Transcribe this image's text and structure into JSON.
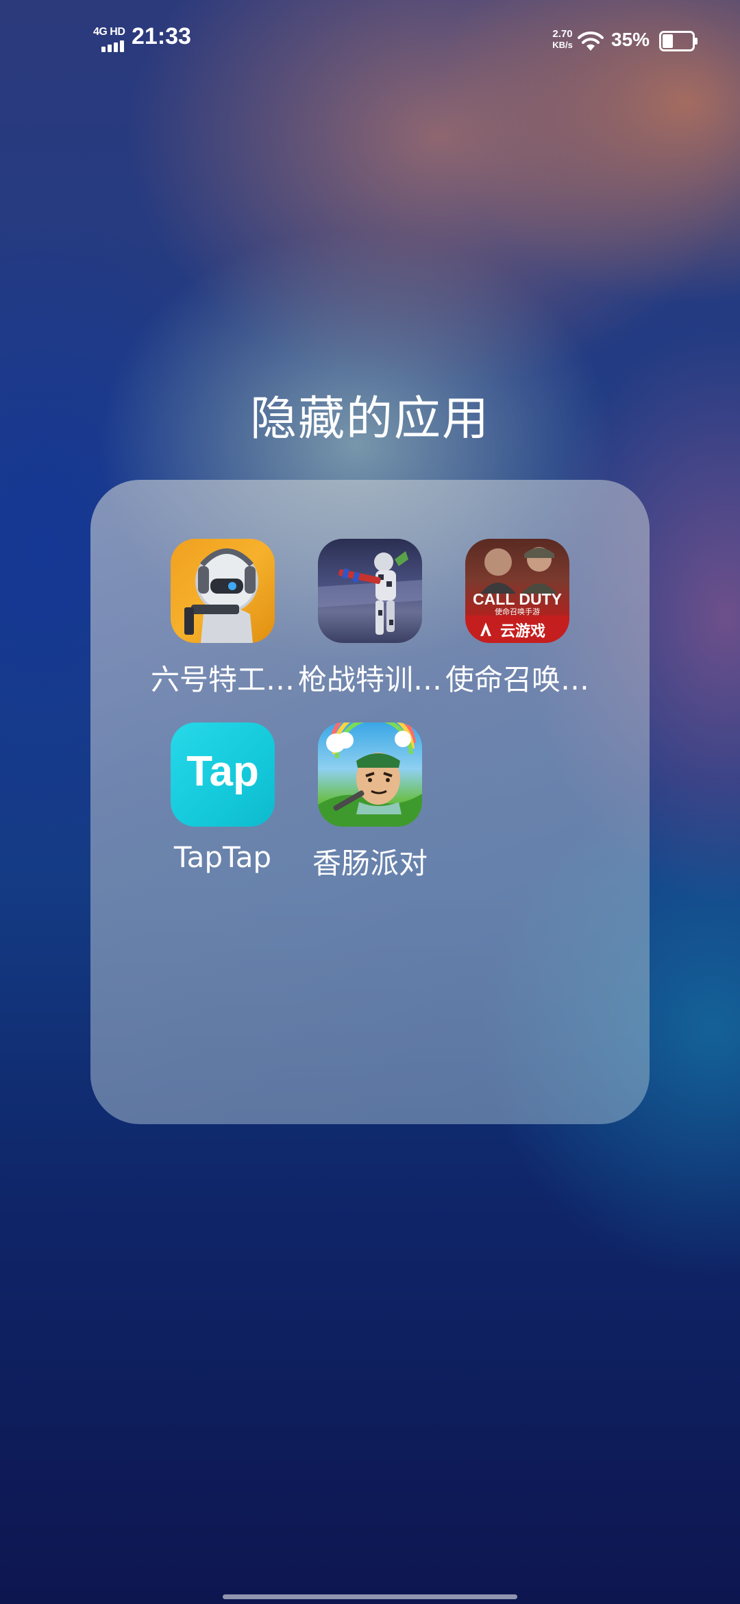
{
  "status_bar": {
    "network": "4G HD",
    "time": "21:33",
    "speed_value": "2.70",
    "speed_unit": "KB/s",
    "battery_percent": "35%",
    "battery_level": 0.35
  },
  "folder": {
    "title": "隐藏的应用",
    "apps": [
      {
        "label": "六号特工…",
        "icon": "agent-six-icon"
      },
      {
        "label": "枪战特训…",
        "icon": "gun-training-icon"
      },
      {
        "label": "使命召唤…",
        "icon": "call-of-duty-icon",
        "icon_text_1": "CALL DUTY",
        "icon_text_2": "使命召唤手游",
        "icon_text_3": "云游戏"
      },
      {
        "label": "TapTap",
        "icon": "taptap-icon",
        "icon_text": "Tap"
      },
      {
        "label": "香肠派对",
        "icon": "sausage-party-icon"
      }
    ]
  },
  "colors": {
    "taptap_brand": "#14c9db",
    "cod_red": "#c51e1e"
  }
}
